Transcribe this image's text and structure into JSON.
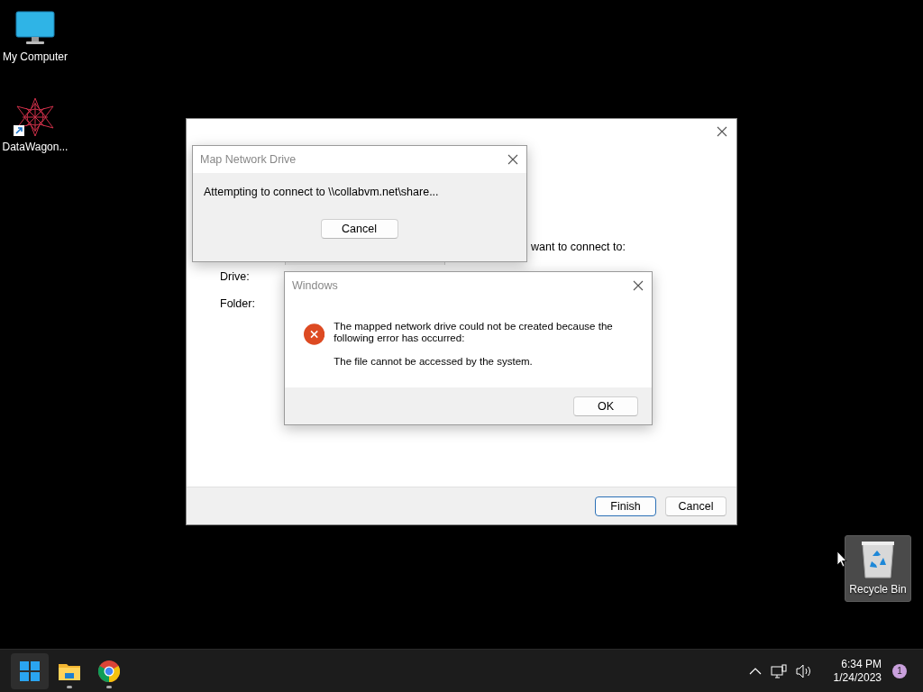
{
  "desktop_icons": [
    {
      "label": "My Computer",
      "kind": "computer",
      "selected": false
    },
    {
      "label": "DataWagon...",
      "kind": "shortcut",
      "selected": false
    },
    {
      "label": "Recycle Bin",
      "kind": "recycle-bin",
      "selected": true
    }
  ],
  "wizard": {
    "partial_text": "want to connect to:",
    "fields": [
      {
        "label": "Drive:",
        "kind": "dropdown"
      },
      {
        "label": "Folder:",
        "kind": "label"
      }
    ],
    "buttons": [
      {
        "label": "Finish",
        "default": true
      },
      {
        "label": "Cancel",
        "default": false
      }
    ]
  },
  "progress_dialog": {
    "title": "Map Network Drive",
    "message": "Attempting to connect to \\\\collabvm.net\\share...",
    "buttons": [
      {
        "label": "Cancel",
        "default": false
      }
    ]
  },
  "error_dialog": {
    "title": "Windows",
    "kind": "error",
    "message": "The mapped network drive could not be created because the following error has occurred:",
    "detail": "The file cannot be accessed by the system.",
    "buttons": [
      {
        "label": "OK",
        "default": false
      }
    ]
  },
  "taskbar": {
    "apps": [
      {
        "kind": "start",
        "running": false,
        "highlighted": true
      },
      {
        "kind": "file-explorer",
        "running": true,
        "highlighted": false
      },
      {
        "kind": "browser",
        "running": true,
        "highlighted": false
      }
    ],
    "tray": {
      "time": "6:34 PM",
      "date": "1/24/2023",
      "notification_count": "1"
    }
  }
}
